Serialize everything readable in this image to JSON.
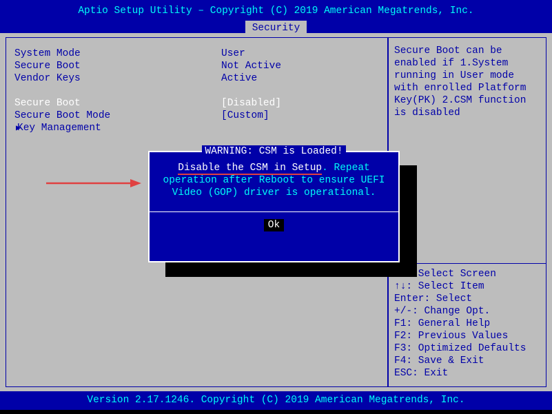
{
  "header": {
    "title": "Aptio Setup Utility – Copyright (C) 2019 American Megatrends, Inc.",
    "tab": "Security"
  },
  "left": {
    "system_mode_label": "System Mode",
    "system_mode_value": "User",
    "secure_boot_status_label": "Secure Boot",
    "secure_boot_status_value": "Not Active",
    "vendor_keys_label": "Vendor Keys",
    "vendor_keys_value": "Active",
    "secure_boot_setting_label": "Secure Boot",
    "secure_boot_setting_value": "[Disabled]",
    "secure_boot_mode_label": "Secure Boot Mode",
    "secure_boot_mode_value": "[Custom]",
    "key_management_label": "Key Management"
  },
  "right": {
    "help_text": "Secure Boot can be enabled if 1.System running in User mode with enrolled Platform Key(PK) 2.CSM function is disabled",
    "hints": {
      "select_screen": "→←: Select Screen",
      "select_item": "↑↓: Select Item",
      "enter": "Enter: Select",
      "change": "+/-: Change Opt.",
      "f1": "F1: General Help",
      "f2": "F2: Previous Values",
      "f3": "F3: Optimized Defaults",
      "f4": "F4: Save & Exit",
      "esc": "ESC: Exit"
    }
  },
  "dialog": {
    "title": " WARNING: CSM is Loaded! ",
    "highlight": "Disable the CSM in Setup",
    "body_rest": ". Repeat operation after Reboot to ensure UEFI Video (GOP) driver is operational.",
    "ok": "Ok"
  },
  "footer": {
    "text": "Version 2.17.1246. Copyright (C) 2019 American Megatrends, Inc."
  }
}
